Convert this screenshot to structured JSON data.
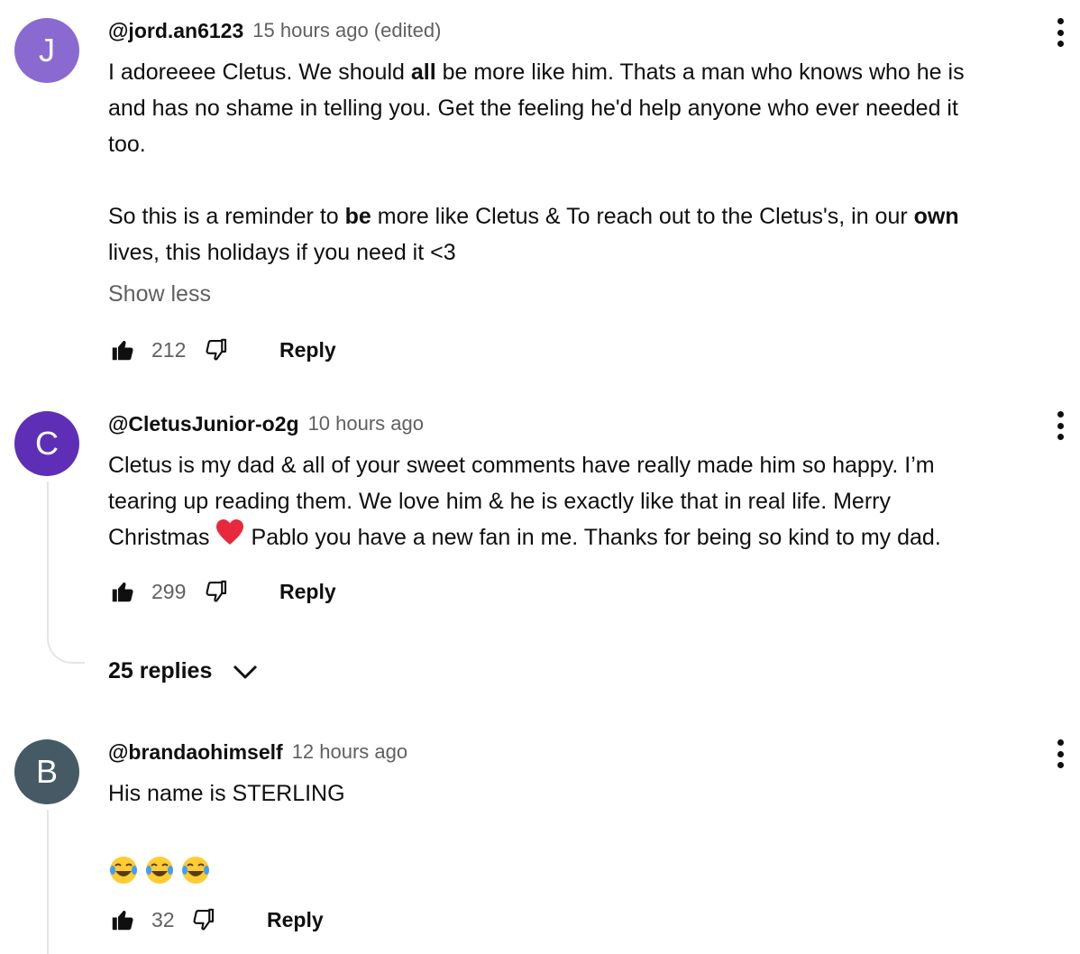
{
  "colors": {
    "avatar_j": "#8a6ad1",
    "avatar_c": "#5e2fb6",
    "avatar_b": "#455a64",
    "muted": "#606060"
  },
  "comments": [
    {
      "avatar_letter": "J",
      "author": "@jord.an6123",
      "time": "15 hours ago (edited)",
      "lines": [
        [
          "I adoreeee Cletus. We should ",
          "all",
          " be more like him. Thats a man who knows who he is"
        ],
        "and has no shame in telling you. Get the feeling he'd help anyone who ever needed it",
        "too.",
        "",
        [
          "So this is a reminder to ",
          "be",
          " more like Cletus & To reach out to the Cletus's, in our ",
          "own"
        ],
        "lives, this holidays if you need it <3"
      ],
      "show_less": "Show less",
      "likes": "212",
      "reply_label": "Reply"
    },
    {
      "avatar_letter": "C",
      "author": "@CletusJunior-o2g",
      "time": "10 hours ago",
      "text_1": "Cletus is my dad & all of your sweet comments have really made him so happy. I’m",
      "text_2": "tearing up reading them. We love him & he is exactly like that in real life. Merry",
      "text_3a": "Christmas",
      "text_3b": "Pablo you have a new fan in me. Thanks for being so kind to my dad.",
      "likes": "299",
      "reply_label": "Reply",
      "replies_label": "25 replies"
    },
    {
      "avatar_letter": "B",
      "author": "@brandaohimself",
      "time": "12 hours ago",
      "text_1": "His name is STERLING",
      "likes": "32",
      "reply_label": "Reply"
    }
  ],
  "icons": {
    "like": "thumbs-up-icon",
    "dislike": "thumbs-down-icon",
    "more": "more-vert-icon",
    "chevron": "chevron-down-icon",
    "emoji": "face-with-tears-of-joy-icon",
    "heart": "red-heart-icon"
  }
}
